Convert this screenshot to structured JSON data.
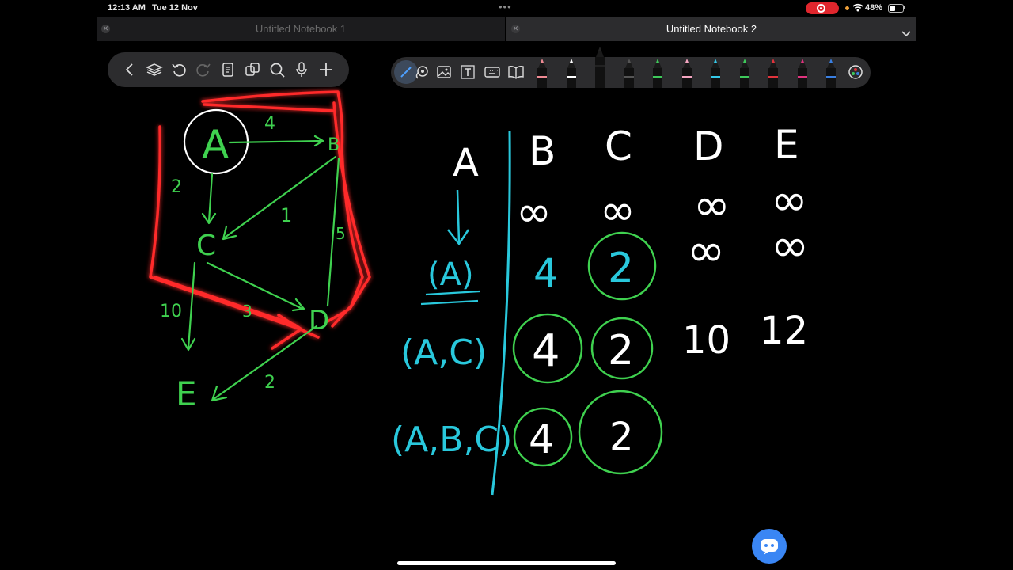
{
  "status_bar": {
    "time": "12:13 AM",
    "date": "Tue 12 Nov",
    "battery": "48%"
  },
  "tabs": [
    {
      "title": "Untitled Notebook 1",
      "active": false
    },
    {
      "title": "Untitled Notebook 2",
      "active": true
    }
  ],
  "left_toolbar": [
    "back-icon",
    "layers-icon",
    "undo-icon",
    "redo-icon",
    "page-icon",
    "duplicate-icon",
    "search-icon",
    "microphone-icon",
    "add-icon"
  ],
  "right_toolbar": [
    "pen-icon",
    "lasso-icon",
    "image-icon",
    "textbox-icon",
    "keyboard-icon",
    "book-icon"
  ],
  "pen_colors": [
    "#ef8a93",
    "#ffffff",
    "#222222",
    "#555555",
    "#3ec95a",
    "#f4a5c0",
    "#35c8e8",
    "#3ec95a",
    "#e0333c",
    "#e0337e",
    "#3a7fe0"
  ],
  "ink_colors": {
    "green": "#3fd14f",
    "red": "#ff2a2a",
    "cyan": "#29c8dc",
    "white": "#ffffff"
  },
  "graph": {
    "nodes": [
      "A",
      "B",
      "C",
      "D",
      "E"
    ],
    "edge_weights": [
      "4",
      "2",
      "1",
      "5",
      "10",
      "3",
      "2"
    ]
  },
  "table": {
    "headers": [
      "A",
      "B",
      "C",
      "D",
      "E"
    ],
    "steps": [
      "(A)",
      "(A,C)",
      "(A,B,C)"
    ],
    "rows": [
      [
        "∞",
        "∞",
        "∞",
        "∞"
      ],
      [
        "4",
        "2",
        "∞",
        "∞"
      ],
      [
        "4",
        "2",
        "10",
        "12"
      ],
      [
        "4",
        "2",
        "",
        ""
      ]
    ]
  }
}
